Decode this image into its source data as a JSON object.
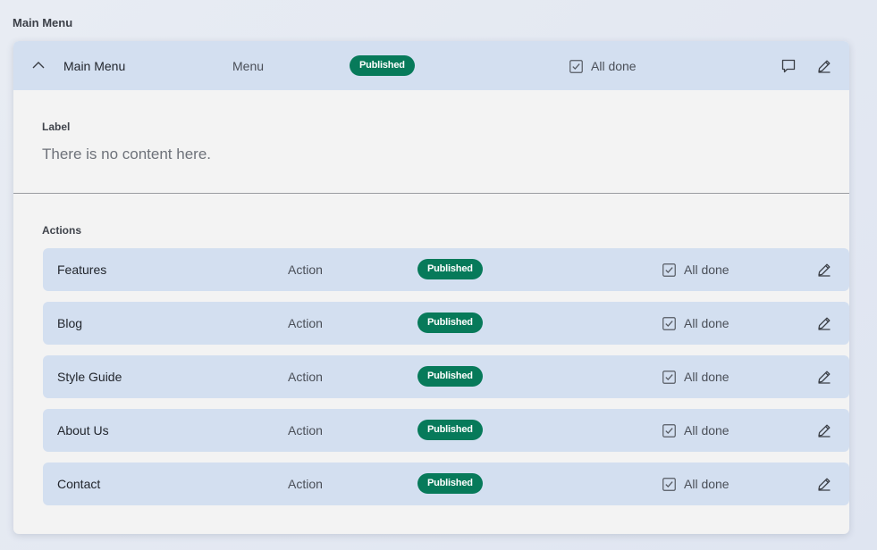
{
  "page": {
    "section_title": "Main Menu"
  },
  "header": {
    "title": "Main Menu",
    "type": "Menu",
    "badge": "Published",
    "status": "All done",
    "icons": [
      "chevron-up-icon",
      "comment-icon",
      "edit-icon"
    ]
  },
  "label_section": {
    "heading": "Label",
    "empty_text": "There is no content here."
  },
  "actions_section": {
    "heading": "Actions",
    "rows": [
      {
        "name": "Features",
        "type": "Action",
        "badge": "Published",
        "status": "All done"
      },
      {
        "name": "Blog",
        "type": "Action",
        "badge": "Published",
        "status": "All done"
      },
      {
        "name": "Style Guide",
        "type": "Action",
        "badge": "Published",
        "status": "All done"
      },
      {
        "name": "About Us",
        "type": "Action",
        "badge": "Published",
        "status": "All done"
      },
      {
        "name": "Contact",
        "type": "Action",
        "badge": "Published",
        "status": "All done"
      }
    ]
  },
  "colors": {
    "badge_green": "#077a5a",
    "row_blue": "#d3dff0",
    "card_bg": "#f3f3f3"
  }
}
